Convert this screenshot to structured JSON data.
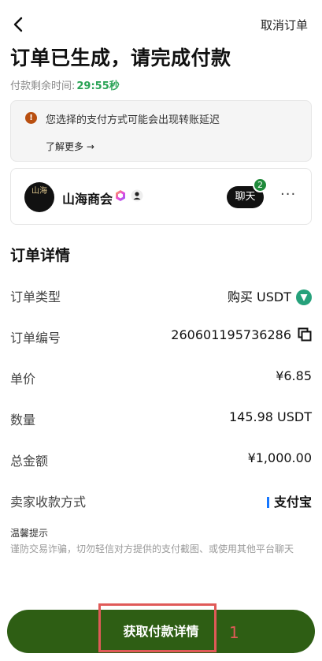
{
  "header": {
    "back_icon": "chevron-left-icon",
    "cancel_label": "取消订单"
  },
  "page_title": "订单已生成，请完成付款",
  "timer": {
    "label": "付款剩余时间:",
    "value": "29:55秒",
    "value_color": "#2aa356"
  },
  "notice": {
    "icon": "warning-icon",
    "message": "您选择的支付方式可能会出现转账延迟",
    "link": "了解更多 →"
  },
  "merchant": {
    "avatar_text": "山海",
    "name": "山海商会",
    "chat_label": "聊天",
    "chat_count": "2"
  },
  "order": {
    "section_title": "订单详情",
    "rows": [
      {
        "label": "订单类型",
        "value": "购买 USDT"
      },
      {
        "label": "订单编号",
        "value": "260601195736286"
      },
      {
        "label": "单价",
        "value": "¥6.85"
      },
      {
        "label": "数量",
        "value": "145.98 USDT"
      },
      {
        "label": "总金额",
        "value": "¥1,000.00"
      },
      {
        "label": "卖家收款方式",
        "value": "支付宝"
      }
    ]
  },
  "tips": {
    "title": "温馨提示",
    "text": "谨防交易诈骗，切勿轻信对方提供的支付截图、或使用其他平台聊天"
  },
  "cta": {
    "label": "获取付款详情",
    "color": "#2e5e14"
  },
  "annotation": {
    "number": "1",
    "color": "#e05a58"
  }
}
